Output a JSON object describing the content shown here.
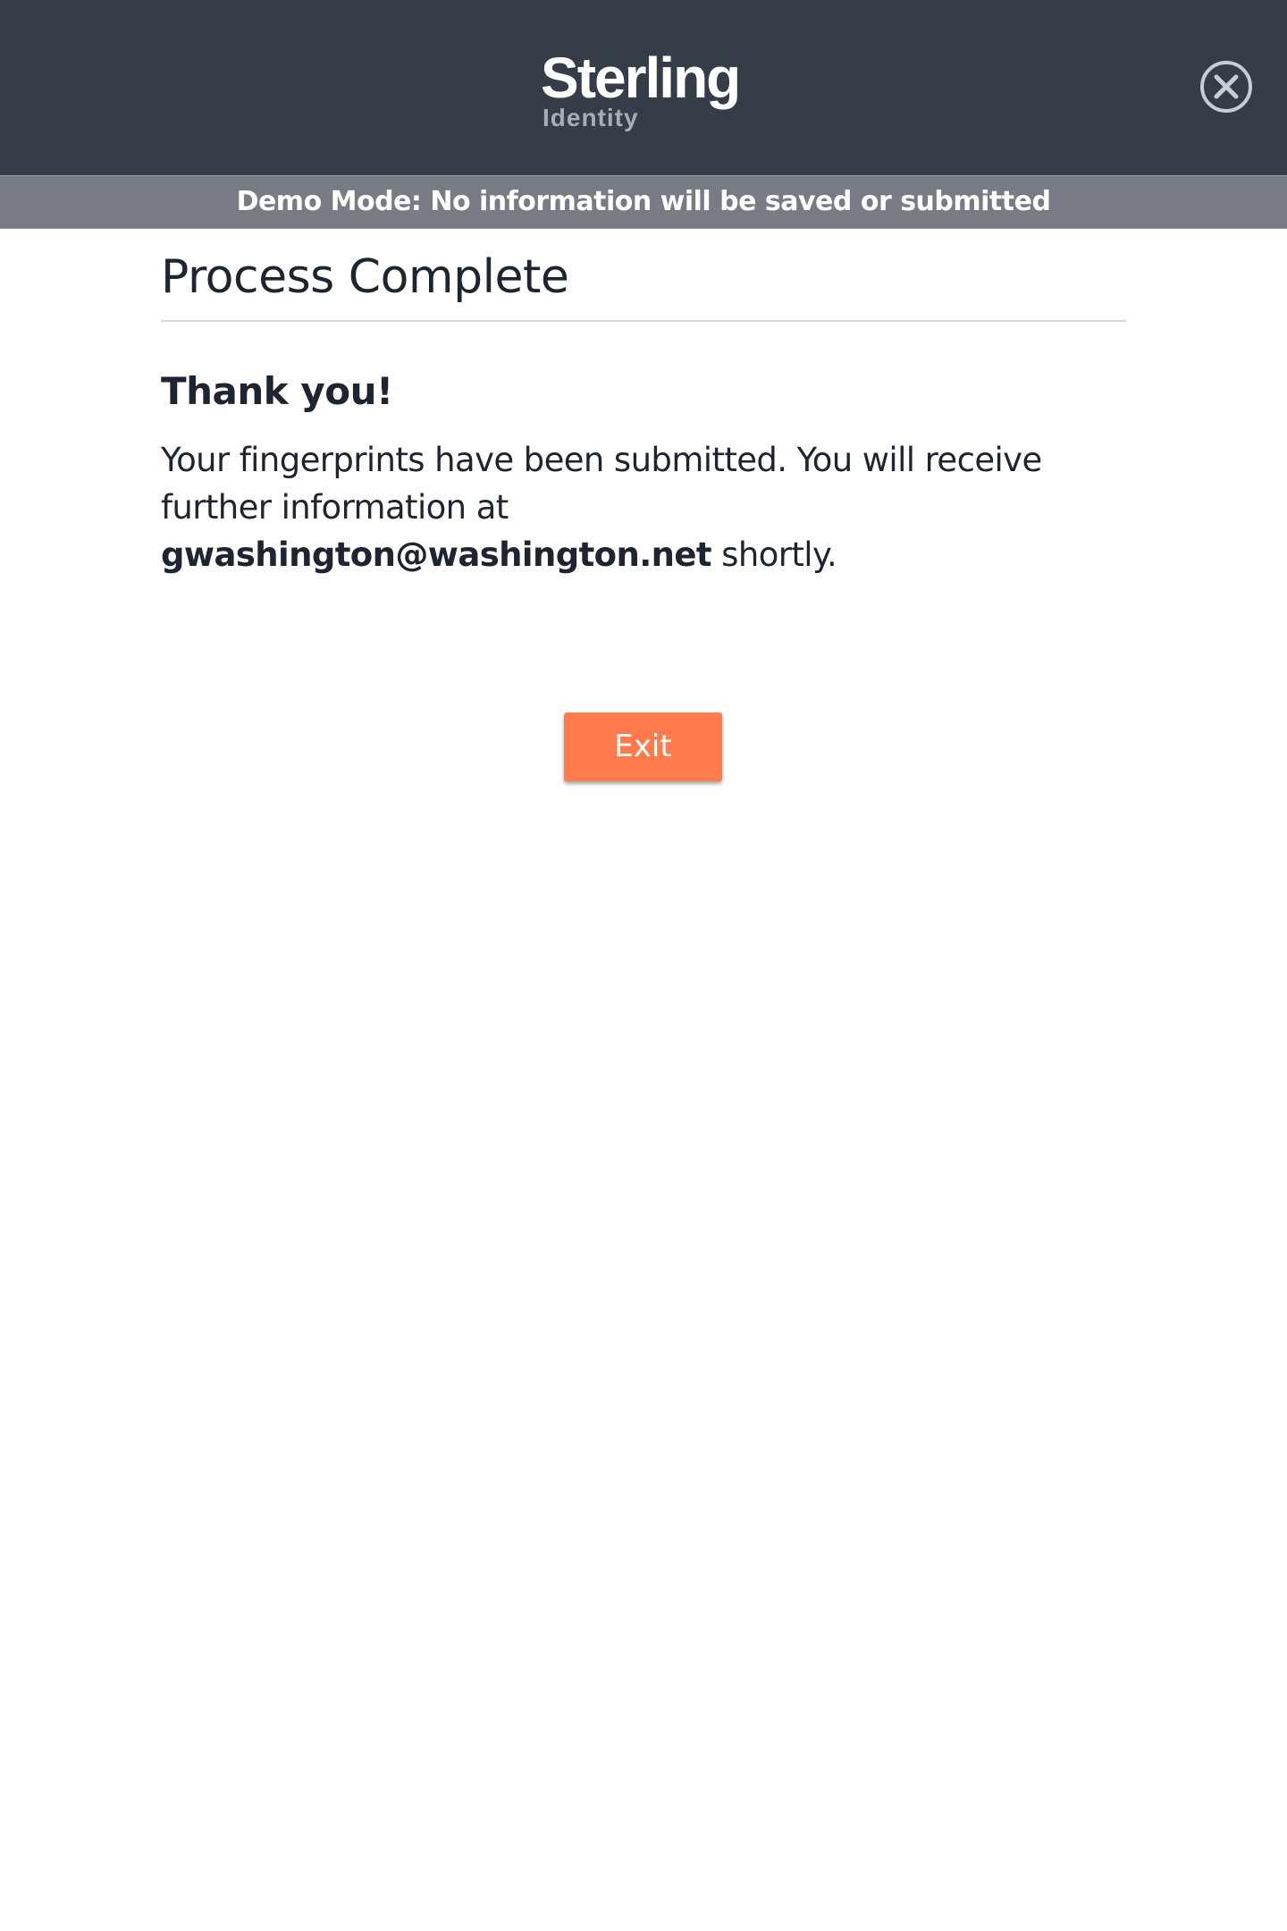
{
  "header": {
    "logo_name": "Sterling",
    "logo_subtitle": "Identity",
    "close_icon": "close-circle-icon",
    "background": "#353e48"
  },
  "demo_banner": {
    "text": "Demo Mode: No information will be saved or submitted",
    "background": "#777b83"
  },
  "main": {
    "title": "Process Complete",
    "heading": "Thank you!",
    "message_before": "Your fingerprints have been submitted. You will receive further information at ",
    "email": "gwashington@washington.net",
    "message_after": " shortly.",
    "exit_label": "Exit",
    "accent": "#ff7b4c"
  }
}
